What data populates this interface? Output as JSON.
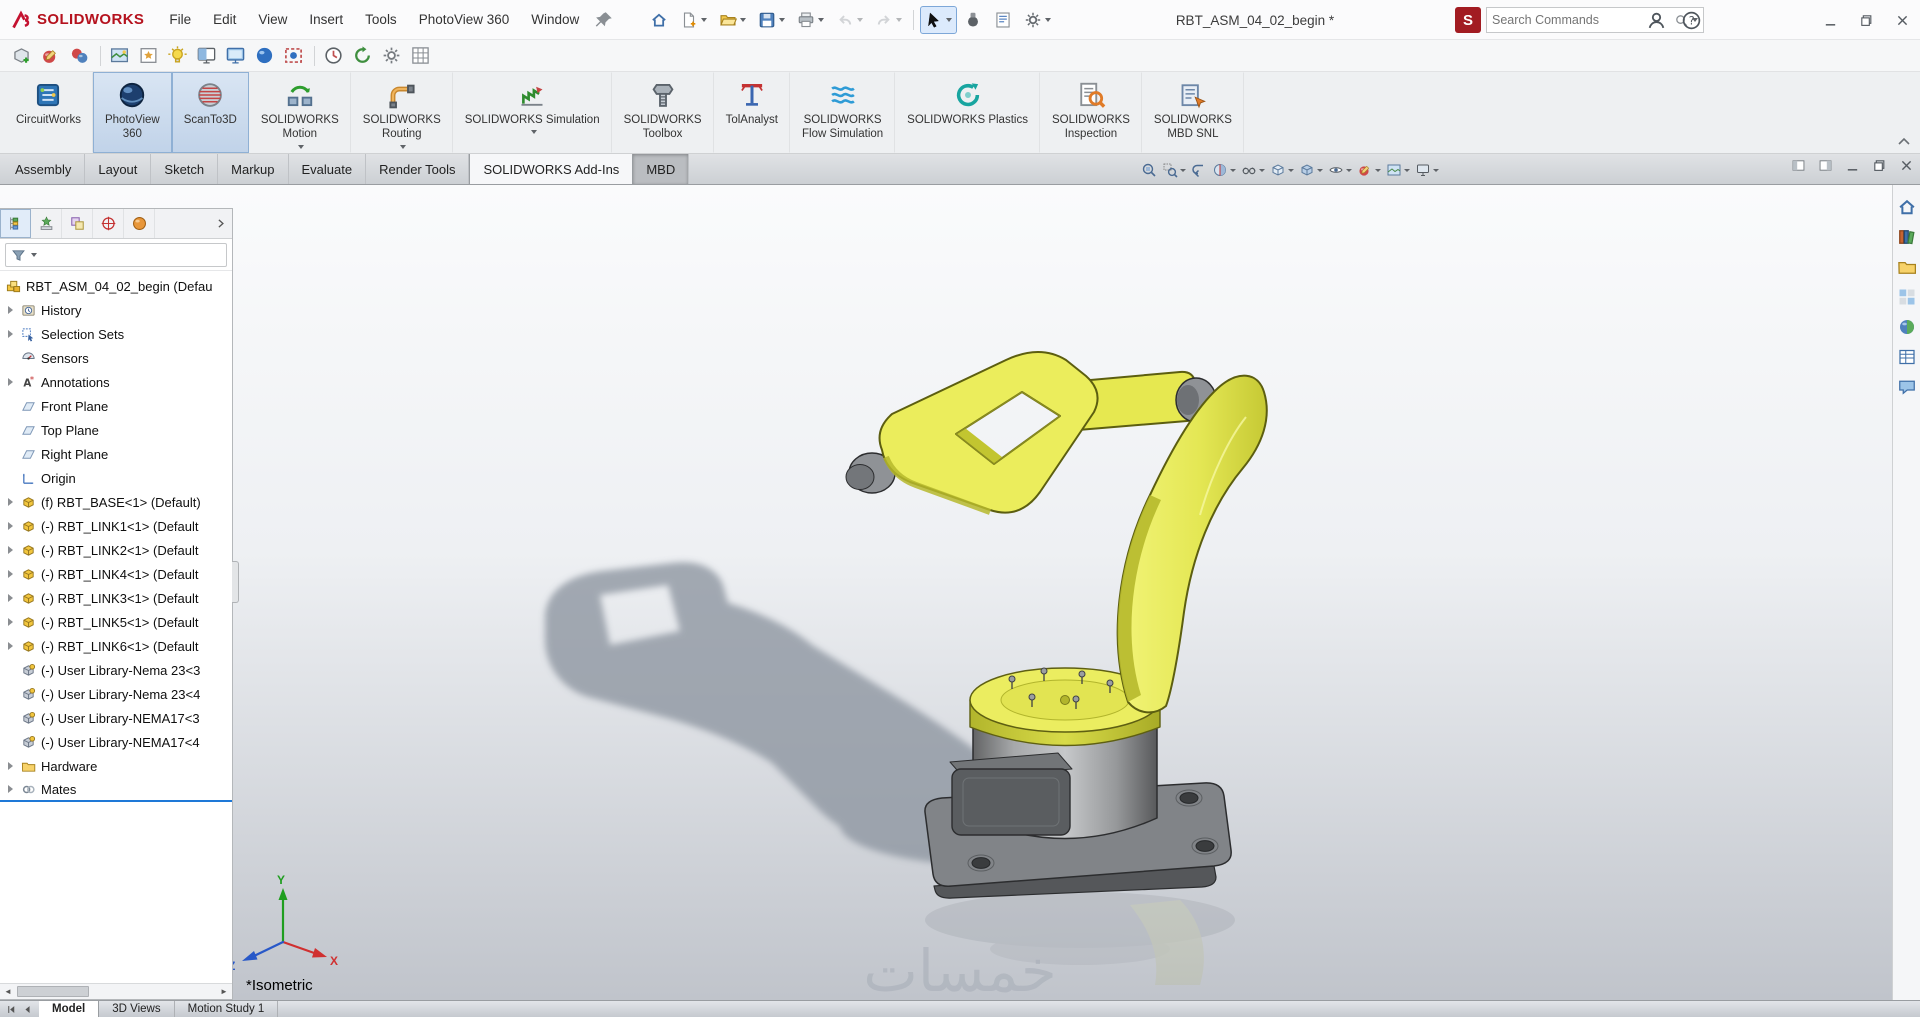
{
  "window": {
    "brand": "SOLIDWORKS",
    "title": "RBT_ASM_04_02_begin *",
    "search_placeholder": "Search Commands"
  },
  "menus": [
    {
      "label": "File"
    },
    {
      "label": "Edit"
    },
    {
      "label": "View"
    },
    {
      "label": "Insert"
    },
    {
      "label": "Tools"
    },
    {
      "label": "PhotoView 360"
    },
    {
      "label": "Window"
    }
  ],
  "quick_tools": [
    {
      "name": "home-icon",
      "caret": false
    },
    {
      "name": "new-document-icon",
      "caret": true
    },
    {
      "name": "open-icon",
      "caret": true
    },
    {
      "name": "save-icon",
      "caret": true
    },
    {
      "name": "print-icon",
      "caret": true
    },
    {
      "name": "undo-icon",
      "caret": true,
      "disabled": true
    },
    {
      "name": "redo-icon",
      "caret": true,
      "disabled": true
    },
    {
      "sep": true
    },
    {
      "name": "select-cursor-icon",
      "caret": true,
      "pressed": true
    },
    {
      "name": "spaceball-icon",
      "caret": false
    },
    {
      "name": "file-properties-icon",
      "caret": false
    },
    {
      "name": "options-gear-icon",
      "caret": true
    }
  ],
  "render_toolbar": [
    {
      "name": "new-render-icon"
    },
    {
      "name": "edit-appearance-icon"
    },
    {
      "name": "copy-appearance-icon"
    },
    {
      "sep": true
    },
    {
      "name": "edit-scene-icon"
    },
    {
      "name": "edit-decal-icon"
    },
    {
      "name": "edit-lights-icon"
    },
    {
      "name": "integrated-preview-icon"
    },
    {
      "name": "preview-window-icon"
    },
    {
      "name": "final-render-icon"
    },
    {
      "name": "render-region-icon"
    },
    {
      "sep": true
    },
    {
      "name": "schedule-render-icon"
    },
    {
      "name": "recall-last-render-icon"
    },
    {
      "name": "photoview-options-icon"
    },
    {
      "name": "proof-sheet-icon"
    }
  ],
  "addins": [
    {
      "label": "CircuitWorks",
      "lines": [
        "CircuitWorks"
      ],
      "icon": "circuitworks-icon",
      "active": false,
      "caret": false
    },
    {
      "label": "PhotoView 360",
      "lines": [
        "PhotoView",
        "360"
      ],
      "icon": "photoview-360-icon",
      "active": true,
      "caret": false
    },
    {
      "label": "ScanTo3D",
      "lines": [
        "ScanTo3D"
      ],
      "icon": "scanto3d-icon",
      "active": true,
      "caret": false
    },
    {
      "label": "SOLIDWORKS Motion",
      "lines": [
        "SOLIDWORKS",
        "Motion"
      ],
      "icon": "motion-icon",
      "active": false,
      "caret": true
    },
    {
      "label": "SOLIDWORKS Routing",
      "lines": [
        "SOLIDWORKS",
        "Routing"
      ],
      "icon": "routing-icon",
      "active": false,
      "caret": true
    },
    {
      "label": "SOLIDWORKS Simulation",
      "lines": [
        "SOLIDWORKS Simulation"
      ],
      "icon": "simulation-icon",
      "active": false,
      "caret": true
    },
    {
      "label": "SOLIDWORKS Toolbox",
      "lines": [
        "SOLIDWORKS",
        "Toolbox"
      ],
      "icon": "toolbox-icon",
      "active": false,
      "caret": false
    },
    {
      "label": "TolAnalyst",
      "lines": [
        "TolAnalyst"
      ],
      "icon": "tolanalyst-icon",
      "active": false,
      "caret": false
    },
    {
      "label": "SOLIDWORKS Flow Simulation",
      "lines": [
        "SOLIDWORKS",
        "Flow Simulation"
      ],
      "icon": "flow-simulation-icon",
      "active": false,
      "caret": false
    },
    {
      "label": "SOLIDWORKS Plastics",
      "lines": [
        "SOLIDWORKS Plastics"
      ],
      "icon": "plastics-icon",
      "active": false,
      "caret": false
    },
    {
      "label": "SOLIDWORKS Inspection",
      "lines": [
        "SOLIDWORKS",
        "Inspection"
      ],
      "icon": "inspection-icon",
      "active": false,
      "caret": false
    },
    {
      "label": "SOLIDWORKS MBD SNL",
      "lines": [
        "SOLIDWORKS",
        "MBD SNL"
      ],
      "icon": "mbd-snl-icon",
      "active": false,
      "caret": false
    }
  ],
  "command_tabs": {
    "items": [
      "Assembly",
      "Layout",
      "Sketch",
      "Markup",
      "Evaluate",
      "Render Tools",
      "SOLIDWORKS Add-Ins",
      "MBD"
    ],
    "active": "SOLIDWORKS Add-Ins",
    "pressed": "MBD"
  },
  "headsup": [
    {
      "name": "zoom-to-fit-icon",
      "caret": false
    },
    {
      "name": "zoom-to-area-icon",
      "caret": true
    },
    {
      "name": "previous-view-icon",
      "caret": false
    },
    {
      "name": "section-view-icon",
      "caret": true
    },
    {
      "name": "dynamic-annotation-icon",
      "caret": true
    },
    {
      "name": "view-orientation-icon",
      "caret": true
    },
    {
      "name": "display-style-icon",
      "caret": true
    },
    {
      "name": "hide-show-items-icon",
      "caret": true
    },
    {
      "name": "edit-appearance-icon",
      "caret": true
    },
    {
      "name": "apply-scene-icon",
      "caret": true
    },
    {
      "name": "view-settings-icon",
      "caret": true
    }
  ],
  "panel_tabs": [
    {
      "name": "feature-tree-icon",
      "active": true
    },
    {
      "name": "property-manager-icon",
      "active": false
    },
    {
      "name": "configuration-manager-icon",
      "active": false
    },
    {
      "name": "dimxpert-manager-icon",
      "active": false
    },
    {
      "name": "display-manager-icon",
      "active": false
    }
  ],
  "feature_tree": {
    "items": [
      {
        "level": 0,
        "icon": "assembly",
        "label": "RBT_ASM_04_02_begin (Defau",
        "arrow": false
      },
      {
        "level": 1,
        "icon": "history",
        "label": "History",
        "arrow": true
      },
      {
        "level": 1,
        "icon": "selection-sets",
        "label": "Selection Sets",
        "arrow": true
      },
      {
        "level": 1,
        "icon": "sensors",
        "label": "Sensors",
        "arrow": false
      },
      {
        "level": 1,
        "icon": "annotations",
        "label": "Annotations",
        "arrow": true
      },
      {
        "level": 1,
        "icon": "plane",
        "label": "Front Plane",
        "arrow": false
      },
      {
        "level": 1,
        "icon": "plane",
        "label": "Top Plane",
        "arrow": false
      },
      {
        "level": 1,
        "icon": "plane",
        "label": "Right Plane",
        "arrow": false
      },
      {
        "level": 1,
        "icon": "origin",
        "label": "Origin",
        "arrow": false
      },
      {
        "level": 1,
        "icon": "part",
        "label": "(f) RBT_BASE<1> (Default)",
        "arrow": true
      },
      {
        "level": 1,
        "icon": "part",
        "label": "(-) RBT_LINK1<1> (Default",
        "arrow": true
      },
      {
        "level": 1,
        "icon": "part",
        "label": "(-) RBT_LINK2<1> (Default",
        "arrow": true
      },
      {
        "level": 1,
        "icon": "part",
        "label": "(-) RBT_LINK4<1> (Default",
        "arrow": true
      },
      {
        "level": 1,
        "icon": "part",
        "label": "(-) RBT_LINK3<1> (Default",
        "arrow": true
      },
      {
        "level": 1,
        "icon": "part",
        "label": "(-) RBT_LINK5<1> (Default",
        "arrow": true
      },
      {
        "level": 1,
        "icon": "part",
        "label": "(-) RBT_LINK6<1> (Default",
        "arrow": true
      },
      {
        "level": 1,
        "icon": "part-lib",
        "label": "(-) User Library-Nema 23<3",
        "arrow": false
      },
      {
        "level": 1,
        "icon": "part-lib",
        "label": "(-) User Library-Nema 23<4",
        "arrow": false
      },
      {
        "level": 1,
        "icon": "part-lib",
        "label": "(-) User Library-NEMA17<3",
        "arrow": false
      },
      {
        "level": 1,
        "icon": "part-lib",
        "label": "(-) User Library-NEMA17<4",
        "arrow": false
      },
      {
        "level": 1,
        "icon": "folder",
        "label": "Hardware",
        "arrow": true
      },
      {
        "level": 1,
        "icon": "mates",
        "label": "Mates",
        "arrow": true,
        "selected": true
      }
    ]
  },
  "viewport": {
    "view_label": "*Isometric",
    "watermark": "خمسات",
    "triad_x": "X",
    "triad_y": "Y",
    "triad_z": "Z"
  },
  "task_pane": [
    {
      "name": "home-icon"
    },
    {
      "name": "design-library-icon"
    },
    {
      "name": "file-explorer-icon"
    },
    {
      "name": "view-palette-icon"
    },
    {
      "name": "appearances-scenes-icon"
    },
    {
      "name": "custom-properties-icon"
    },
    {
      "name": "forum-icon"
    }
  ],
  "bottom_tabs": {
    "items": [
      "Model",
      "3D Views",
      "Motion Study 1"
    ],
    "active": "Model"
  },
  "colors": {
    "accent": "#1e78d7",
    "brand_red": "#b5121e",
    "robot_yellow": "#e8e550",
    "steel_gray": "#8a8f96"
  }
}
